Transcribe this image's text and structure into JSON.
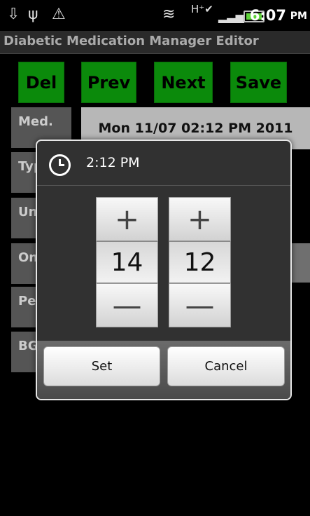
{
  "status_bar": {
    "time": "6:07",
    "ampm": "PM",
    "icons": [
      "download-icon",
      "usb-icon",
      "warning-icon",
      "wifi-icon",
      "hplus-data-icon",
      "signal-icon",
      "battery-icon"
    ]
  },
  "title_bar": {
    "title": "Diabetic Medication Manager Editor"
  },
  "toolbar": {
    "del_label": "Del",
    "prev_label": "Prev",
    "next_label": "Next",
    "save_label": "Save",
    "button_color": "#0b8a0b"
  },
  "form": {
    "labels": [
      "Med.",
      "Typ",
      "Un",
      "On",
      "Pea",
      "BG"
    ],
    "date_value": "Mon 11/07 02:12 PM 2011"
  },
  "time_dialog": {
    "title": "2:12 PM",
    "hour_value": "14",
    "minute_value": "12",
    "plus_symbol": "+",
    "minus_symbol": "—",
    "set_label": "Set",
    "cancel_label": "Cancel"
  }
}
